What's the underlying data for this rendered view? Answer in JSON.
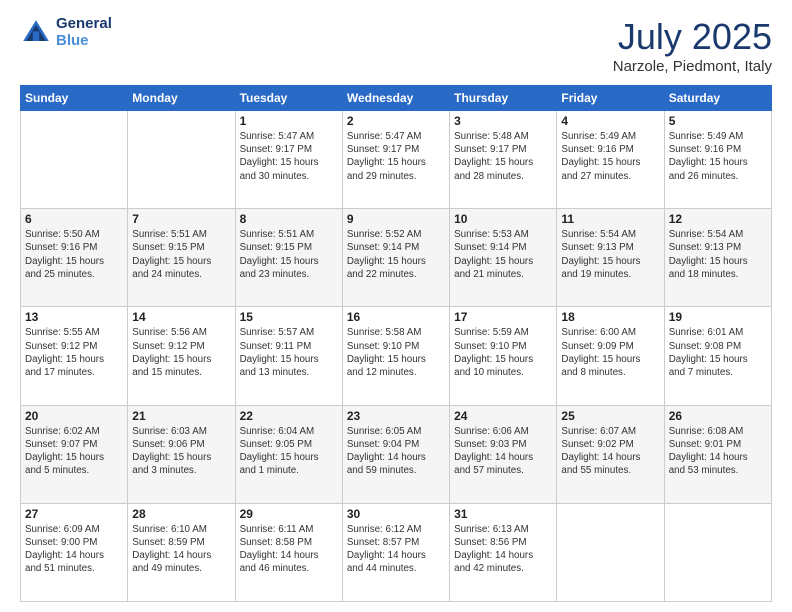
{
  "logo": {
    "line1": "General",
    "line2": "Blue"
  },
  "title": "July 2025",
  "subtitle": "Narzole, Piedmont, Italy",
  "days_of_week": [
    "Sunday",
    "Monday",
    "Tuesday",
    "Wednesday",
    "Thursday",
    "Friday",
    "Saturday"
  ],
  "weeks": [
    [
      {
        "day": "",
        "info": ""
      },
      {
        "day": "",
        "info": ""
      },
      {
        "day": "1",
        "info": "Sunrise: 5:47 AM\nSunset: 9:17 PM\nDaylight: 15 hours\nand 30 minutes."
      },
      {
        "day": "2",
        "info": "Sunrise: 5:47 AM\nSunset: 9:17 PM\nDaylight: 15 hours\nand 29 minutes."
      },
      {
        "day": "3",
        "info": "Sunrise: 5:48 AM\nSunset: 9:17 PM\nDaylight: 15 hours\nand 28 minutes."
      },
      {
        "day": "4",
        "info": "Sunrise: 5:49 AM\nSunset: 9:16 PM\nDaylight: 15 hours\nand 27 minutes."
      },
      {
        "day": "5",
        "info": "Sunrise: 5:49 AM\nSunset: 9:16 PM\nDaylight: 15 hours\nand 26 minutes."
      }
    ],
    [
      {
        "day": "6",
        "info": "Sunrise: 5:50 AM\nSunset: 9:16 PM\nDaylight: 15 hours\nand 25 minutes."
      },
      {
        "day": "7",
        "info": "Sunrise: 5:51 AM\nSunset: 9:15 PM\nDaylight: 15 hours\nand 24 minutes."
      },
      {
        "day": "8",
        "info": "Sunrise: 5:51 AM\nSunset: 9:15 PM\nDaylight: 15 hours\nand 23 minutes."
      },
      {
        "day": "9",
        "info": "Sunrise: 5:52 AM\nSunset: 9:14 PM\nDaylight: 15 hours\nand 22 minutes."
      },
      {
        "day": "10",
        "info": "Sunrise: 5:53 AM\nSunset: 9:14 PM\nDaylight: 15 hours\nand 21 minutes."
      },
      {
        "day": "11",
        "info": "Sunrise: 5:54 AM\nSunset: 9:13 PM\nDaylight: 15 hours\nand 19 minutes."
      },
      {
        "day": "12",
        "info": "Sunrise: 5:54 AM\nSunset: 9:13 PM\nDaylight: 15 hours\nand 18 minutes."
      }
    ],
    [
      {
        "day": "13",
        "info": "Sunrise: 5:55 AM\nSunset: 9:12 PM\nDaylight: 15 hours\nand 17 minutes."
      },
      {
        "day": "14",
        "info": "Sunrise: 5:56 AM\nSunset: 9:12 PM\nDaylight: 15 hours\nand 15 minutes."
      },
      {
        "day": "15",
        "info": "Sunrise: 5:57 AM\nSunset: 9:11 PM\nDaylight: 15 hours\nand 13 minutes."
      },
      {
        "day": "16",
        "info": "Sunrise: 5:58 AM\nSunset: 9:10 PM\nDaylight: 15 hours\nand 12 minutes."
      },
      {
        "day": "17",
        "info": "Sunrise: 5:59 AM\nSunset: 9:10 PM\nDaylight: 15 hours\nand 10 minutes."
      },
      {
        "day": "18",
        "info": "Sunrise: 6:00 AM\nSunset: 9:09 PM\nDaylight: 15 hours\nand 8 minutes."
      },
      {
        "day": "19",
        "info": "Sunrise: 6:01 AM\nSunset: 9:08 PM\nDaylight: 15 hours\nand 7 minutes."
      }
    ],
    [
      {
        "day": "20",
        "info": "Sunrise: 6:02 AM\nSunset: 9:07 PM\nDaylight: 15 hours\nand 5 minutes."
      },
      {
        "day": "21",
        "info": "Sunrise: 6:03 AM\nSunset: 9:06 PM\nDaylight: 15 hours\nand 3 minutes."
      },
      {
        "day": "22",
        "info": "Sunrise: 6:04 AM\nSunset: 9:05 PM\nDaylight: 15 hours\nand 1 minute."
      },
      {
        "day": "23",
        "info": "Sunrise: 6:05 AM\nSunset: 9:04 PM\nDaylight: 14 hours\nand 59 minutes."
      },
      {
        "day": "24",
        "info": "Sunrise: 6:06 AM\nSunset: 9:03 PM\nDaylight: 14 hours\nand 57 minutes."
      },
      {
        "day": "25",
        "info": "Sunrise: 6:07 AM\nSunset: 9:02 PM\nDaylight: 14 hours\nand 55 minutes."
      },
      {
        "day": "26",
        "info": "Sunrise: 6:08 AM\nSunset: 9:01 PM\nDaylight: 14 hours\nand 53 minutes."
      }
    ],
    [
      {
        "day": "27",
        "info": "Sunrise: 6:09 AM\nSunset: 9:00 PM\nDaylight: 14 hours\nand 51 minutes."
      },
      {
        "day": "28",
        "info": "Sunrise: 6:10 AM\nSunset: 8:59 PM\nDaylight: 14 hours\nand 49 minutes."
      },
      {
        "day": "29",
        "info": "Sunrise: 6:11 AM\nSunset: 8:58 PM\nDaylight: 14 hours\nand 46 minutes."
      },
      {
        "day": "30",
        "info": "Sunrise: 6:12 AM\nSunset: 8:57 PM\nDaylight: 14 hours\nand 44 minutes."
      },
      {
        "day": "31",
        "info": "Sunrise: 6:13 AM\nSunset: 8:56 PM\nDaylight: 14 hours\nand 42 minutes."
      },
      {
        "day": "",
        "info": ""
      },
      {
        "day": "",
        "info": ""
      }
    ]
  ]
}
